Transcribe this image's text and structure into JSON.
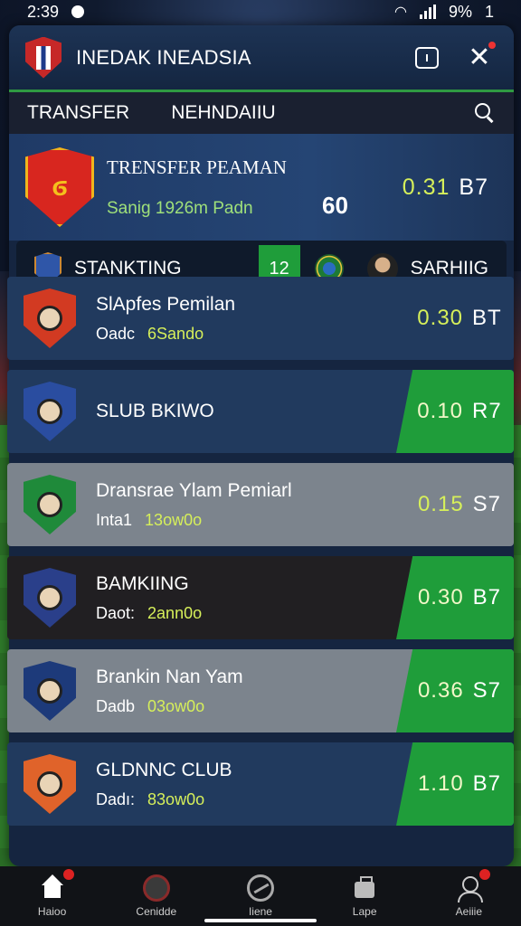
{
  "status_bar": {
    "time": "2:39",
    "battery": "9%",
    "sim": "1"
  },
  "header": {
    "title": "INEDAK INEADSIA"
  },
  "tabs": [
    {
      "label": "TRANSFER"
    },
    {
      "label": "NEHNDAIIU"
    }
  ],
  "featured": {
    "title": "TRENSFER PEAMAN",
    "sub": "Sanig 1926m Padn",
    "mid": "60",
    "odds_value": "0.31",
    "odds_unit": "B7"
  },
  "standing": {
    "label": "STANKTING",
    "score": "12",
    "right_label": "SARHIIG"
  },
  "rows": [
    {
      "name": "SlApfes Pemilan",
      "sub_a": "Oadc",
      "sub_b": "6Sando",
      "odds_value": "0.30",
      "odds_unit": "BT",
      "style": "blue",
      "green": false,
      "badge_color": "#d23a22"
    },
    {
      "name": "SLUB BKIWO",
      "sub_a": "",
      "sub_b": "",
      "odds_value": "0.10",
      "odds_unit": "R7",
      "style": "blue",
      "green": true,
      "badge_color": "#2a4da0"
    },
    {
      "name": "Dransrae Ylam Pemiarl",
      "sub_a": "Inta1",
      "sub_b": "13ow0o",
      "odds_value": "0.15",
      "odds_unit": "S7",
      "style": "gray",
      "green": false,
      "badge_color": "#1f8a3a"
    },
    {
      "name": "BAMKIING",
      "sub_a": "Daot:",
      "sub_b": "2ann0o",
      "odds_value": "0.30",
      "odds_unit": "B7",
      "style": "dark",
      "green": true,
      "badge_color": "#2a3f8a"
    },
    {
      "name": "Brankin Nan Yam",
      "sub_a": "Dadb",
      "sub_b": "03ow0o",
      "odds_value": "0.36",
      "odds_unit": "S7",
      "style": "gray",
      "green": true,
      "badge_color": "#1d3a7a"
    },
    {
      "name": "GLDNNC CLUB",
      "sub_a": "Dadı:",
      "sub_b": "83ow0o",
      "odds_value": "1.10",
      "odds_unit": "B7",
      "style": "blue",
      "green": true,
      "badge_color": "#e0632a"
    }
  ],
  "nav": [
    {
      "label": "Haioo",
      "icon": "home-icon"
    },
    {
      "label": "Cenidde",
      "icon": "shield-icon"
    },
    {
      "label": "Iiene",
      "icon": "circle-icon"
    },
    {
      "label": "Lape",
      "icon": "bag-icon"
    },
    {
      "label": "Aeiiie",
      "icon": "user-icon"
    }
  ],
  "colors": {
    "accent_green": "#1f9d3a",
    "odds_yellow": "#d6ef5a",
    "panel": "#152540"
  }
}
